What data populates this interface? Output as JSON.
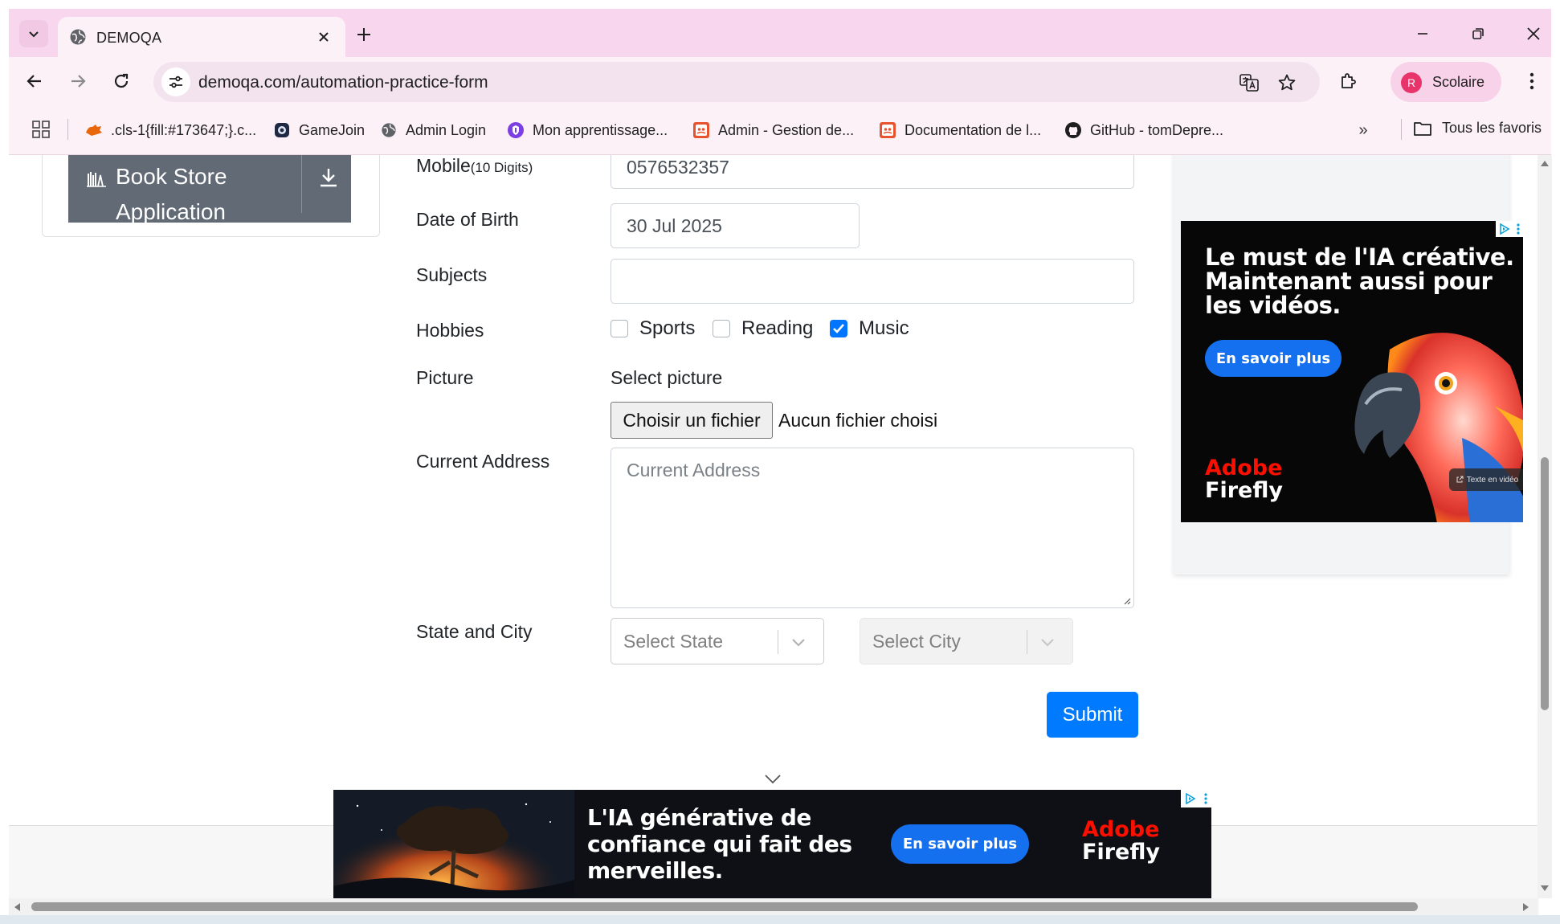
{
  "browser": {
    "tab_title": "DEMOQA",
    "url": "demoqa.com/automation-practice-form",
    "profile_initial": "R",
    "profile_name": "Scolaire",
    "bookmarks": [
      {
        "label": ".cls-1{fill:#173647;}.c...",
        "icon": "hand-icon"
      },
      {
        "label": "GameJoin",
        "icon": "gamepad-icon"
      },
      {
        "label": "Admin Login",
        "icon": "globe-icon"
      },
      {
        "label": "Mon apprentissage...",
        "icon": "shield-icon"
      },
      {
        "label": "Admin - Gestion de...",
        "icon": "ghost-icon"
      },
      {
        "label": "Documentation de l...",
        "icon": "ghost-icon"
      },
      {
        "label": "GitHub - tomDepre...",
        "icon": "github-icon"
      }
    ],
    "all_bookmarks_label": "Tous les favoris",
    "more_bookmarks": "»"
  },
  "sidebar": {
    "bookstore_label": "Book Store Application"
  },
  "form": {
    "mobile_label": "Mobile",
    "mobile_hint": "(10 Digits)",
    "mobile_value": "0576532357",
    "dob_label": "Date of Birth",
    "dob_value": "30 Jul 2025",
    "subjects_label": "Subjects",
    "subjects_value": "",
    "hobbies_label": "Hobbies",
    "hobbies": [
      {
        "label": "Sports",
        "checked": false
      },
      {
        "label": "Reading",
        "checked": false
      },
      {
        "label": "Music",
        "checked": true
      }
    ],
    "picture_label": "Picture",
    "picture_prompt": "Select picture",
    "file_button": "Choisir un fichier",
    "file_status": "Aucun fichier choisi",
    "address_label": "Current Address",
    "address_placeholder": "Current Address",
    "state_city_label": "State and City",
    "state_placeholder": "Select State",
    "city_placeholder": "Select City",
    "submit_label": "Submit"
  },
  "ads": {
    "side_headline_1": "Le must de l'IA créative.",
    "side_headline_2": "Maintenant aussi pour",
    "side_headline_3": "les vidéos.",
    "side_cta": "En savoir plus",
    "side_tag": "Texte en vidéo",
    "brand_1": "Adobe",
    "brand_2": "Firefly",
    "bottom_headline_1": "L'IA générative de",
    "bottom_headline_2": "confiance qui fait des",
    "bottom_headline_3": "merveilles.",
    "bottom_cta": "En savoir plus"
  },
  "colors": {
    "chrome_bg": "#f8d7ee",
    "accent_blue": "#007bff",
    "checkbox_blue": "#0075ff",
    "bookstore_bg": "#616a75",
    "adobe_red": "#fa0f00"
  }
}
